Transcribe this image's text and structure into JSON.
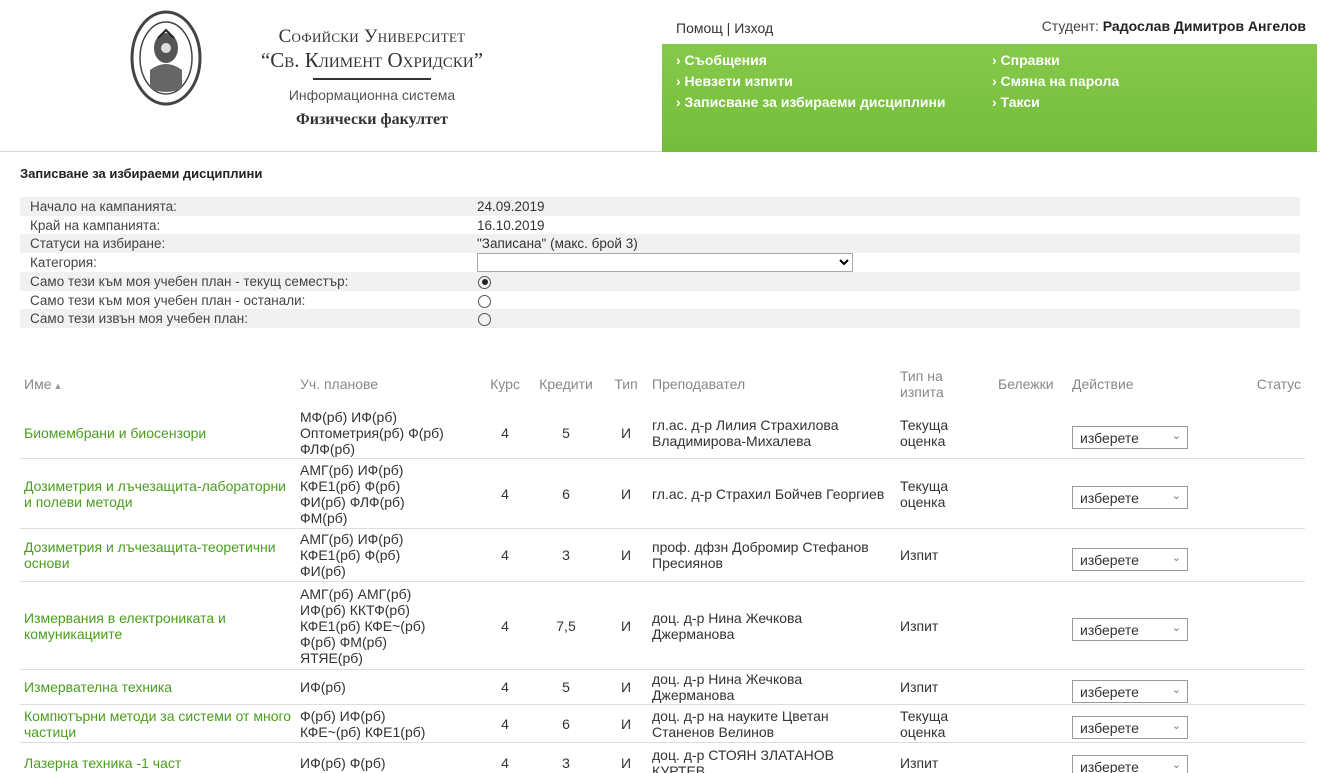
{
  "header": {
    "uni_line1": "Софийски Университет",
    "uni_line2": "“Св. Климент Охридски”",
    "uni_line3": "Информационна система",
    "faculty": "Физически факултет",
    "help": "Помощ",
    "sep": " | ",
    "logout": "Изход",
    "student_label": "Студент:",
    "student_name": "Радослав Димитров Ангелов",
    "menu_col1": [
      "› Съобщения",
      "› Невзети изпити",
      "› Записване за избираеми дисциплини"
    ],
    "menu_col2": [
      "› Справки",
      "› Смяна на парола",
      "› Такси"
    ],
    "accent_color": "#7cc242"
  },
  "page": {
    "title": "Записване за избираеми дисциплини"
  },
  "info": {
    "start_label": "Начало на кампанията:",
    "start_value": "24.09.2019",
    "end_label": "Край на кампанията:",
    "end_value": "16.10.2019",
    "status_label": "Статуси на избиране:",
    "status_value": "\"Записана\" (макс. брой 3)",
    "category_label": "Категория:",
    "category_value": "",
    "opt1_label": "Само тези към моя учебен план - текущ семестър:",
    "opt2_label": "Само тези към моя учебен план - останали:",
    "opt3_label": "Само тези извън моя учебен план:",
    "selected_option": 1
  },
  "table": {
    "headers": {
      "name": "Име",
      "plans": "Уч. планове",
      "course": "Курс",
      "credits": "Кредити",
      "type": "Тип",
      "teacher": "Преподавател",
      "exam_type_1": "Тип на",
      "exam_type_2": "изпита",
      "notes": "Бележки",
      "action": "Действие",
      "status": "Статус"
    },
    "select_label": "изберете",
    "rows": [
      {
        "name": "Биомембрани и биосензори",
        "plans": [
          "МФ(рб) ИФ(рб)",
          "Оптометрия(рб) Ф(рб)",
          "ФЛФ(рб)"
        ],
        "course": "4",
        "credits": "5",
        "type": "И",
        "teacher": [
          "гл.ас. д-р Лилия Страхилова",
          "Владимирова-Михалева"
        ],
        "exam": [
          "Текуща",
          "оценка"
        ]
      },
      {
        "name": "Дозиметрия и лъчезащита-лабораторни и полеви методи",
        "plans": [
          "АМГ(рб) ИФ(рб)",
          "КФЕ1(рб) Ф(рб)",
          "ФИ(рб) ФЛФ(рб)",
          "ФМ(рб)"
        ],
        "course": "4",
        "credits": "6",
        "type": "И",
        "teacher": [
          "гл.ас. д-р Страхил Бойчев Георгиев"
        ],
        "exam": [
          "Текуща",
          "оценка"
        ]
      },
      {
        "name": "Дозиметрия и лъчезащита-теоретични основи",
        "plans": [
          "АМГ(рб) ИФ(рб)",
          "КФЕ1(рб) Ф(рб)",
          "ФИ(рб)"
        ],
        "course": "4",
        "credits": "3",
        "type": "И",
        "teacher": [
          "проф. дфзн Добромир Стефанов",
          "Пресиянов"
        ],
        "exam": [
          "Изпит"
        ]
      },
      {
        "name": "Измервания в електрониката и комуникациите",
        "plans": [
          "АМГ(рб) АМГ(рб)",
          "ИФ(рб) ККТФ(рб)",
          "КФЕ1(рб) КФЕ~(рб)",
          "Ф(рб) ФМ(рб)",
          "ЯТЯЕ(рб)"
        ],
        "course": "4",
        "credits": "7,5",
        "type": "И",
        "teacher": [
          "доц. д-р Нина Жечкова",
          "Джерманова"
        ],
        "exam": [
          "Изпит"
        ]
      },
      {
        "name": "Измервателна техника",
        "plans": [
          "ИФ(рб)"
        ],
        "course": "4",
        "credits": "5",
        "type": "И",
        "teacher": [
          "доц. д-р Нина Жечкова",
          "Джерманова"
        ],
        "exam": [
          "Изпит"
        ]
      },
      {
        "name": "Компютърни методи за системи от много частици",
        "plans": [
          "Ф(рб) ИФ(рб)",
          "КФЕ~(рб) КФЕ1(рб)"
        ],
        "course": "4",
        "credits": "6",
        "type": "И",
        "teacher": [
          "доц. д-р на науките Цветан",
          "Станенов Велинов"
        ],
        "exam": [
          "Текуща",
          "оценка"
        ]
      },
      {
        "name": "Лазерна техника -1 част",
        "plans": [
          "ИФ(рб) Ф(рб)"
        ],
        "course": "4",
        "credits": "3",
        "type": "И",
        "teacher": [
          "доц. д-р СТОЯН ЗЛАТАНОВ",
          "КУРТЕВ"
        ],
        "exam": [
          "Изпит"
        ]
      }
    ]
  }
}
